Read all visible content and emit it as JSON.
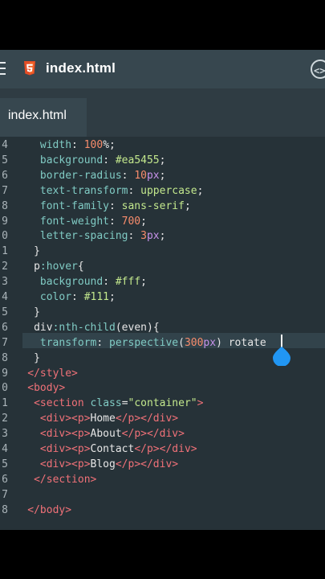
{
  "header": {
    "file_icon": "html5-icon",
    "menu_icon": "hamburger-menu-icon",
    "right_icon": "code-icon",
    "title": "index.html"
  },
  "tabs": [
    {
      "label": "index.html"
    }
  ],
  "colors": {
    "keyword": "#c792ea",
    "property": "#80cbc4",
    "value": "#c3e88d",
    "number": "#f78c6c",
    "tag": "#f07178",
    "accent": "#2196f3"
  },
  "editor": {
    "lines": [
      {
        "n": "4",
        "tokens": [
          {
            "t": "width",
            "c": "property"
          },
          {
            "t": ": ",
            "c": "plain"
          },
          {
            "t": "100",
            "c": "number"
          },
          {
            "t": "%;",
            "c": "plain"
          }
        ],
        "indent": 6
      },
      {
        "n": "5",
        "tokens": [
          {
            "t": "background",
            "c": "property"
          },
          {
            "t": ": ",
            "c": "plain"
          },
          {
            "t": "#ea5455",
            "c": "value"
          },
          {
            "t": ";",
            "c": "plain"
          }
        ],
        "indent": 6
      },
      {
        "n": "6",
        "tokens": [
          {
            "t": "border-radius",
            "c": "property"
          },
          {
            "t": ": ",
            "c": "plain"
          },
          {
            "t": "10",
            "c": "number"
          },
          {
            "t": "px",
            "c": "keyword"
          },
          {
            "t": ";",
            "c": "plain"
          }
        ],
        "indent": 6
      },
      {
        "n": "7",
        "tokens": [
          {
            "t": "text-transform",
            "c": "property"
          },
          {
            "t": ": ",
            "c": "plain"
          },
          {
            "t": "uppercase",
            "c": "value"
          },
          {
            "t": ";",
            "c": "plain"
          }
        ],
        "indent": 6
      },
      {
        "n": "8",
        "tokens": [
          {
            "t": "font-family",
            "c": "property"
          },
          {
            "t": ": ",
            "c": "plain"
          },
          {
            "t": "sans-serif",
            "c": "value"
          },
          {
            "t": ";",
            "c": "plain"
          }
        ],
        "indent": 6
      },
      {
        "n": "9",
        "tokens": [
          {
            "t": "font-weight",
            "c": "property"
          },
          {
            "t": ": ",
            "c": "plain"
          },
          {
            "t": "700",
            "c": "number"
          },
          {
            "t": ";",
            "c": "plain"
          }
        ],
        "indent": 6
      },
      {
        "n": "0",
        "tokens": [
          {
            "t": "letter-spacing",
            "c": "property"
          },
          {
            "t": ": ",
            "c": "plain"
          },
          {
            "t": "3",
            "c": "number"
          },
          {
            "t": "px",
            "c": "keyword"
          },
          {
            "t": ";",
            "c": "plain"
          }
        ],
        "indent": 6
      },
      {
        "n": "1",
        "tokens": [
          {
            "t": "}",
            "c": "plain"
          }
        ],
        "indent": 5
      },
      {
        "n": "2",
        "tokens": [
          {
            "t": "p",
            "c": "plain"
          },
          {
            "t": ":hover",
            "c": "property"
          },
          {
            "t": "{",
            "c": "plain"
          }
        ],
        "indent": 5
      },
      {
        "n": "3",
        "tokens": [
          {
            "t": "background",
            "c": "property"
          },
          {
            "t": ": ",
            "c": "plain"
          },
          {
            "t": "#fff",
            "c": "value"
          },
          {
            "t": ";",
            "c": "plain"
          }
        ],
        "indent": 6
      },
      {
        "n": "4",
        "tokens": [
          {
            "t": "color",
            "c": "property"
          },
          {
            "t": ": ",
            "c": "plain"
          },
          {
            "t": "#111",
            "c": "value"
          },
          {
            "t": ";",
            "c": "plain"
          }
        ],
        "indent": 6
      },
      {
        "n": "5",
        "tokens": [
          {
            "t": "}",
            "c": "plain"
          }
        ],
        "indent": 5
      },
      {
        "n": "6",
        "tokens": [
          {
            "t": "div",
            "c": "plain"
          },
          {
            "t": ":nth-child",
            "c": "property"
          },
          {
            "t": "(even){",
            "c": "plain"
          }
        ],
        "indent": 5
      },
      {
        "n": "7",
        "tokens": [
          {
            "t": "transform",
            "c": "property"
          },
          {
            "t": ": ",
            "c": "plain"
          },
          {
            "t": "perspective",
            "c": "property"
          },
          {
            "t": "(",
            "c": "plain"
          },
          {
            "t": "300",
            "c": "number"
          },
          {
            "t": "px",
            "c": "keyword"
          },
          {
            "t": ") rotate",
            "c": "plain"
          }
        ],
        "indent": 6
      },
      {
        "n": "8",
        "tokens": [
          {
            "t": "}",
            "c": "plain"
          }
        ],
        "indent": 5
      },
      {
        "n": "9",
        "tokens": [
          {
            "t": "</style>",
            "c": "tag"
          }
        ],
        "indent": 4
      },
      {
        "n": "0",
        "tokens": [
          {
            "t": "<body>",
            "c": "tag"
          }
        ],
        "indent": 4
      },
      {
        "n": "1",
        "tokens": [
          {
            "t": "<section ",
            "c": "tag"
          },
          {
            "t": "class",
            "c": "property"
          },
          {
            "t": "=",
            "c": "plain"
          },
          {
            "t": "\"container\"",
            "c": "value"
          },
          {
            "t": ">",
            "c": "tag"
          }
        ],
        "indent": 5
      },
      {
        "n": "2",
        "tokens": [
          {
            "t": "<div><p>",
            "c": "tag"
          },
          {
            "t": "Home",
            "c": "plain"
          },
          {
            "t": "</p></div>",
            "c": "tag"
          }
        ],
        "indent": 6
      },
      {
        "n": "3",
        "tokens": [
          {
            "t": "<div><p>",
            "c": "tag"
          },
          {
            "t": "About",
            "c": "plain"
          },
          {
            "t": "</p></div>",
            "c": "tag"
          }
        ],
        "indent": 6
      },
      {
        "n": "4",
        "tokens": [
          {
            "t": "<div><p>",
            "c": "tag"
          },
          {
            "t": "Contact",
            "c": "plain"
          },
          {
            "t": "</p></div>",
            "c": "tag"
          }
        ],
        "indent": 6
      },
      {
        "n": "5",
        "tokens": [
          {
            "t": "<div><p>",
            "c": "tag"
          },
          {
            "t": "Blog",
            "c": "plain"
          },
          {
            "t": "</p></div>",
            "c": "tag"
          }
        ],
        "indent": 6
      },
      {
        "n": "6",
        "tokens": [
          {
            "t": "</section>",
            "c": "tag"
          }
        ],
        "indent": 5
      },
      {
        "n": "7",
        "tokens": [],
        "indent": 4
      },
      {
        "n": "8",
        "tokens": [
          {
            "t": "</body>",
            "c": "tag"
          }
        ],
        "indent": 4
      }
    ]
  }
}
